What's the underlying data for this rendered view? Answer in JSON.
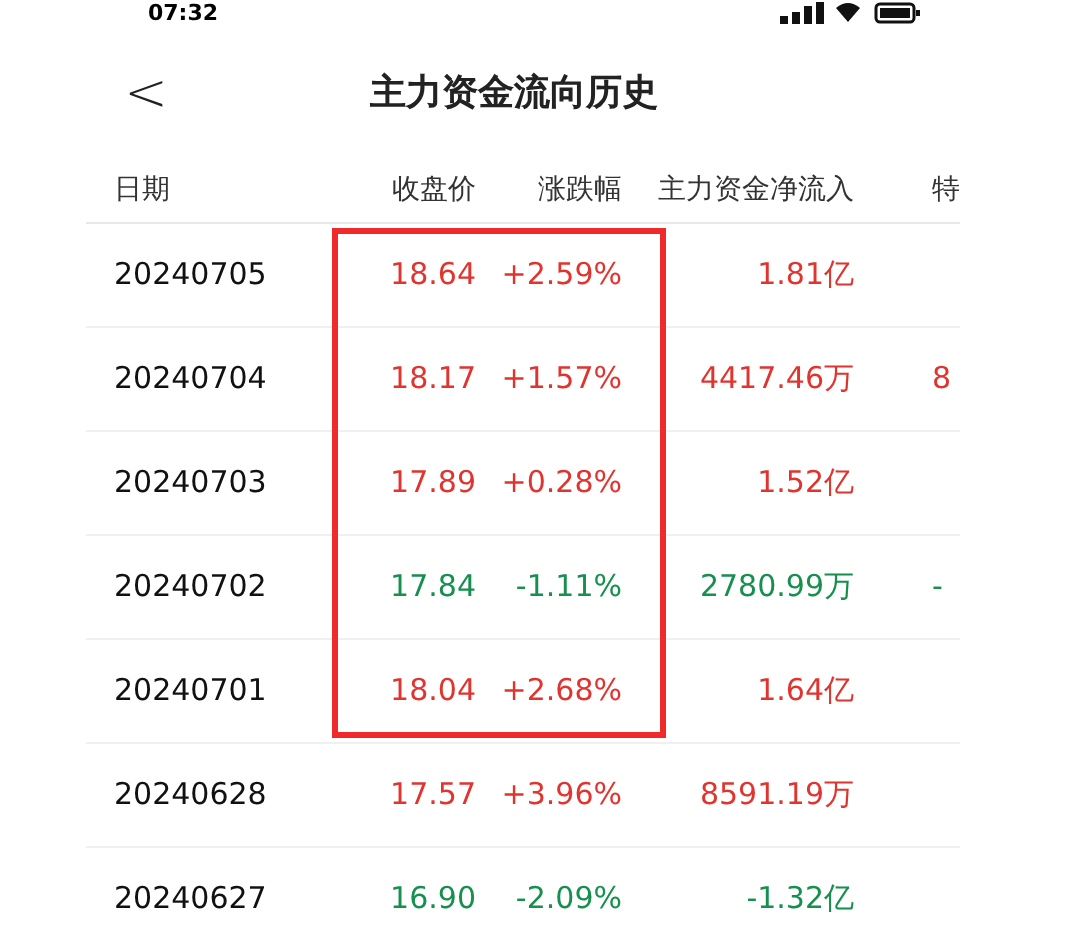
{
  "status_bar": {
    "time": "07:32"
  },
  "header": {
    "back": "<",
    "title": "主力资金流向历史"
  },
  "table": {
    "columns": [
      "日期",
      "收盘价",
      "涨跌幅",
      "主力资金净流入",
      "特"
    ],
    "rows": [
      {
        "date": "20240705",
        "close": "18.64",
        "change": "+2.59%",
        "inflow": "1.81亿",
        "column_5": "",
        "rising": true,
        "highlighted": true
      },
      {
        "date": "20240704",
        "close": "18.17",
        "change": "+1.57%",
        "inflow": "4417.46万",
        "column_5": "8",
        "rising": true,
        "highlighted": true
      },
      {
        "date": "20240703",
        "close": "17.89",
        "change": "+0.28%",
        "inflow": "1.52亿",
        "column_5": "",
        "rising": true,
        "highlighted": true
      },
      {
        "date": "20240702",
        "close": "17.84",
        "change": "-1.11%",
        "inflow": "2780.99万",
        "column_5": "-",
        "rising": false,
        "highlighted": true
      },
      {
        "date": "20240701",
        "close": "18.04",
        "change": "+2.68%",
        "inflow": "1.64亿",
        "column_5": "",
        "rising": true,
        "highlighted": true
      },
      {
        "date": "20240628",
        "close": "17.57",
        "change": "+3.96%",
        "inflow": "8591.19万",
        "column_5": "",
        "rising": true,
        "highlighted": false
      },
      {
        "date": "20240627",
        "close": "16.90",
        "change": "-2.09%",
        "inflow": "-1.32亿",
        "column_5": "",
        "rising": false,
        "highlighted": false
      }
    ]
  }
}
